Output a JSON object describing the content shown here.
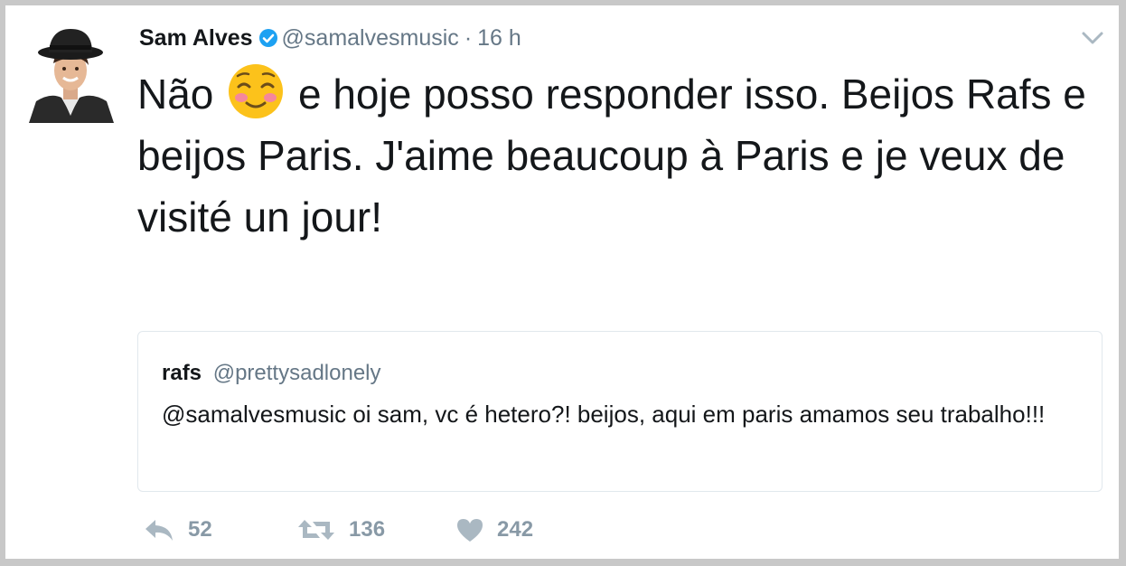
{
  "tweet": {
    "author_name": "Sam Alves",
    "author_handle": "@samalvesmusic",
    "separator": "·",
    "timestamp": "16 h",
    "text_before_emoji": "Não",
    "emoji": "smiling-face-with-blush-emoji",
    "text_after_emoji": "e hoje posso responder isso. Beijos Rafs e beijos Paris. J'aime beaucoup à Paris e je veux de visité un jour!"
  },
  "quoted_tweet": {
    "author_name": "rafs",
    "author_handle": "@prettysadlonely",
    "text": "@samalvesmusic oi sam, vc é hetero?! beijos, aqui em paris amamos seu trabalho!!!"
  },
  "actions": {
    "reply_count": "52",
    "retweet_count": "136",
    "like_count": "242"
  },
  "colors": {
    "verified_blue": "#1da1f2",
    "secondary_text": "#657786",
    "action_gray": "#8899a6"
  }
}
